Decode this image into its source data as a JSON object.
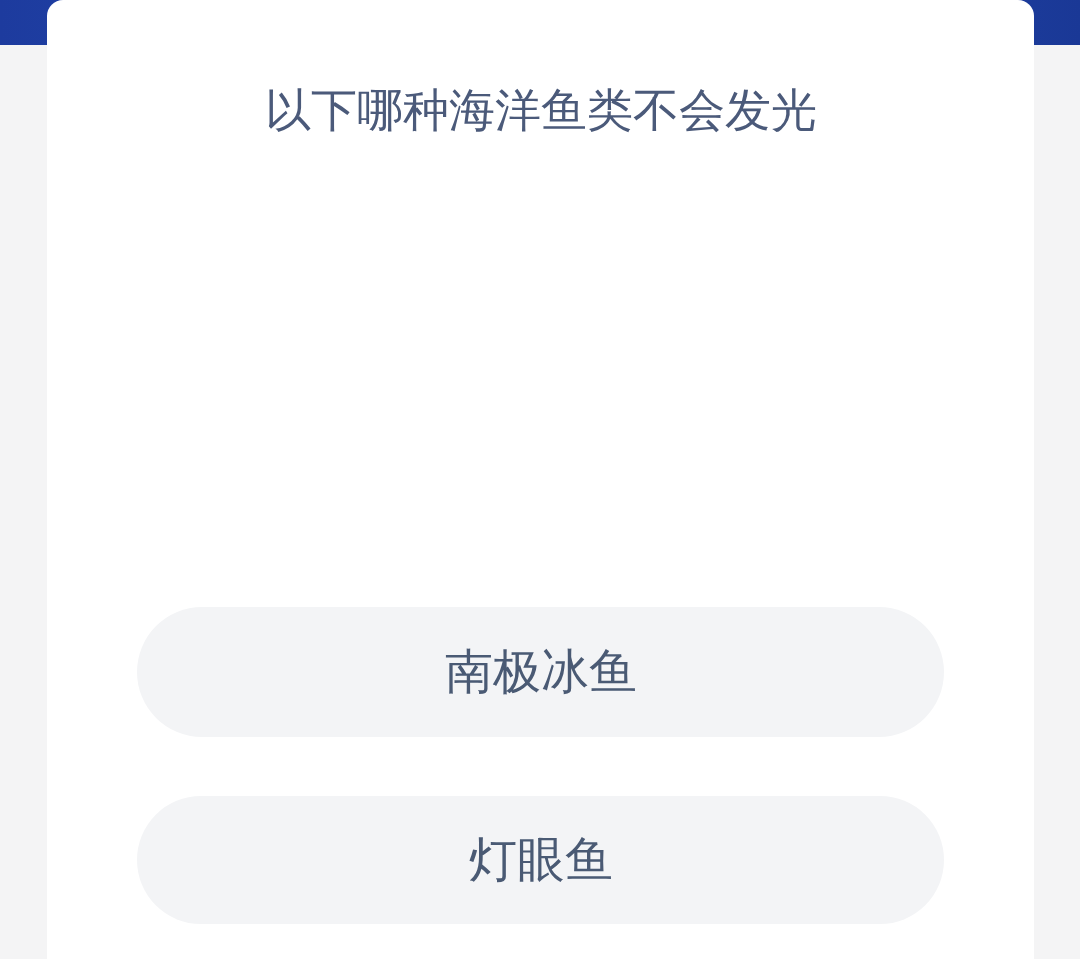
{
  "question": "以下哪种海洋鱼类不会发光",
  "options": [
    {
      "label": "南极冰鱼"
    },
    {
      "label": "灯眼鱼"
    }
  ]
}
